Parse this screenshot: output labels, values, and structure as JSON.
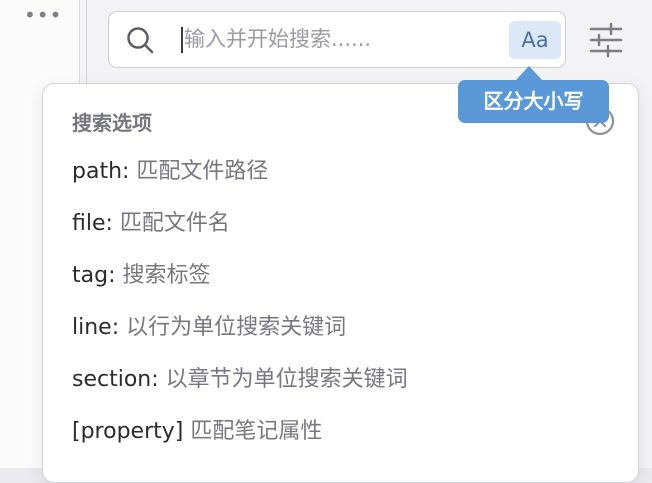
{
  "sidebar": {
    "more_label": "•••",
    "more_icon": "more-horizontal-icon"
  },
  "search": {
    "value": "",
    "placeholder": "输入并开始搜索......",
    "search_icon": "search-icon",
    "case_toggle_label": "Aa",
    "case_toggle_tooltip": "区分大小写",
    "filter_icon": "sliders-icon"
  },
  "popup": {
    "title": "搜索选项",
    "close_icon": "close-circle-icon",
    "options": [
      {
        "key": "path:",
        "description": " 匹配文件路径"
      },
      {
        "key": "file:",
        "description": " 匹配文件名"
      },
      {
        "key": "tag:",
        "description": " 搜索标签"
      },
      {
        "key": "line:",
        "description": " 以行为单位搜索关键词"
      },
      {
        "key": "section:",
        "description": " 以章节为单位搜索关键词"
      },
      {
        "key": "[property]",
        "description": " 匹配笔记属性"
      }
    ]
  },
  "colors": {
    "accent": "#5a98d7",
    "toggle_background": "#dbe8f8",
    "toggle_text": "#4d6f99"
  }
}
